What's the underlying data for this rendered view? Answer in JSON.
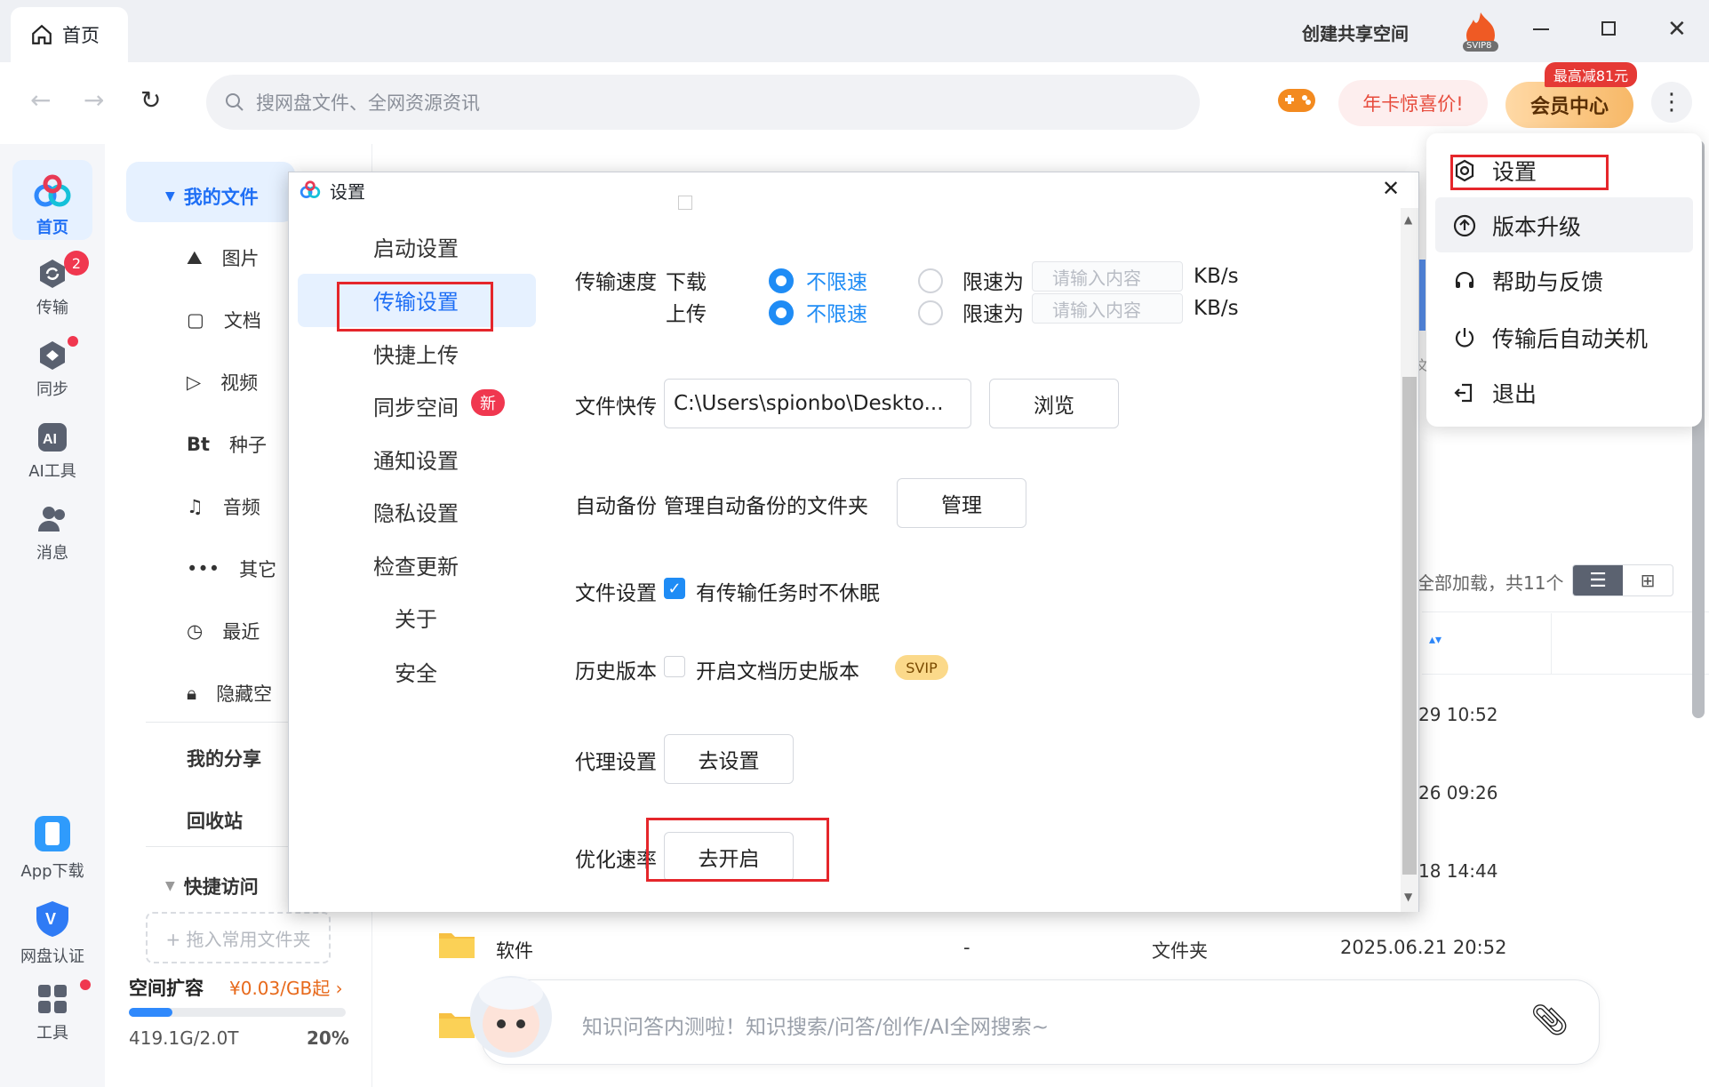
{
  "window": {
    "tab_home": "首页",
    "create_space": "创建共享空间",
    "svip_badge": "SVIP8"
  },
  "nav": {
    "search_placeholder": "搜网盘文件、全网资源资讯",
    "promo": "年卡惊喜价!",
    "vip_center": "会员中心",
    "vip_tag": "最高减81元"
  },
  "rail": {
    "home": "首页",
    "transfer": "传输",
    "transfer_badge": "2",
    "sync": "同步",
    "ai": "AI工具",
    "msg": "消息",
    "app": "App下载",
    "verify": "网盘认证",
    "tools": "工具"
  },
  "sidebar": {
    "my_files": "我的文件",
    "items": [
      "图片",
      "文档",
      "视频",
      "种子",
      "音频",
      "其它",
      "最近",
      "隐藏空"
    ],
    "bt": "Bt",
    "share": "我的分享",
    "recycle": "回收站",
    "quick": "快捷访问",
    "drag_hint": "+ 拖入常用文件夹",
    "space_expand": "空间扩容",
    "space_price": "¥0.03/GB起",
    "space_used": "419.1G/2.0T",
    "space_pct": "20%",
    "space_fraction": 0.2
  },
  "content": {
    "load_text": "全部加载，共11个",
    "dates": [
      "29 10:52",
      "26 09:26",
      "18 14:44"
    ],
    "row": {
      "name": "软件",
      "size": "-",
      "type": "文件夹",
      "date": "2025.06.21 20:52"
    },
    "sort_col": "文",
    "ai_placeholder": "知识问答内测啦！知识搜索/问答/创作/AI全网搜索~"
  },
  "dialog": {
    "title": "设置",
    "nav": [
      "启动设置",
      "传输设置",
      "快捷上传",
      "同步空间",
      "通知设置",
      "隐私设置",
      "检查更新",
      "关于",
      "安全"
    ],
    "new_badge": "新",
    "speed": {
      "label": "传输速度",
      "download": "下载",
      "upload": "上传",
      "unlimited": "不限速",
      "limit": "限速为",
      "placeholder": "请输入内容",
      "unit": "KB/s"
    },
    "quick": {
      "label": "文件快传",
      "path": "C:\\Users\\spionbo\\Deskto...",
      "browse": "浏览"
    },
    "backup": {
      "label": "自动备份",
      "text": "管理自动备份的文件夹",
      "btn": "管理"
    },
    "file": {
      "label": "文件设置",
      "text": "有传输任务时不休眠"
    },
    "history": {
      "label": "历史版本",
      "text": "开启文档历史版本",
      "badge": "SVIP"
    },
    "proxy": {
      "label": "代理设置",
      "btn": "去设置"
    },
    "optimize": {
      "label": "优化速率",
      "btn": "去开启"
    }
  },
  "menu": {
    "items": [
      "设置",
      "版本升级",
      "帮助与反馈",
      "传输后自动关机",
      "退出"
    ]
  }
}
